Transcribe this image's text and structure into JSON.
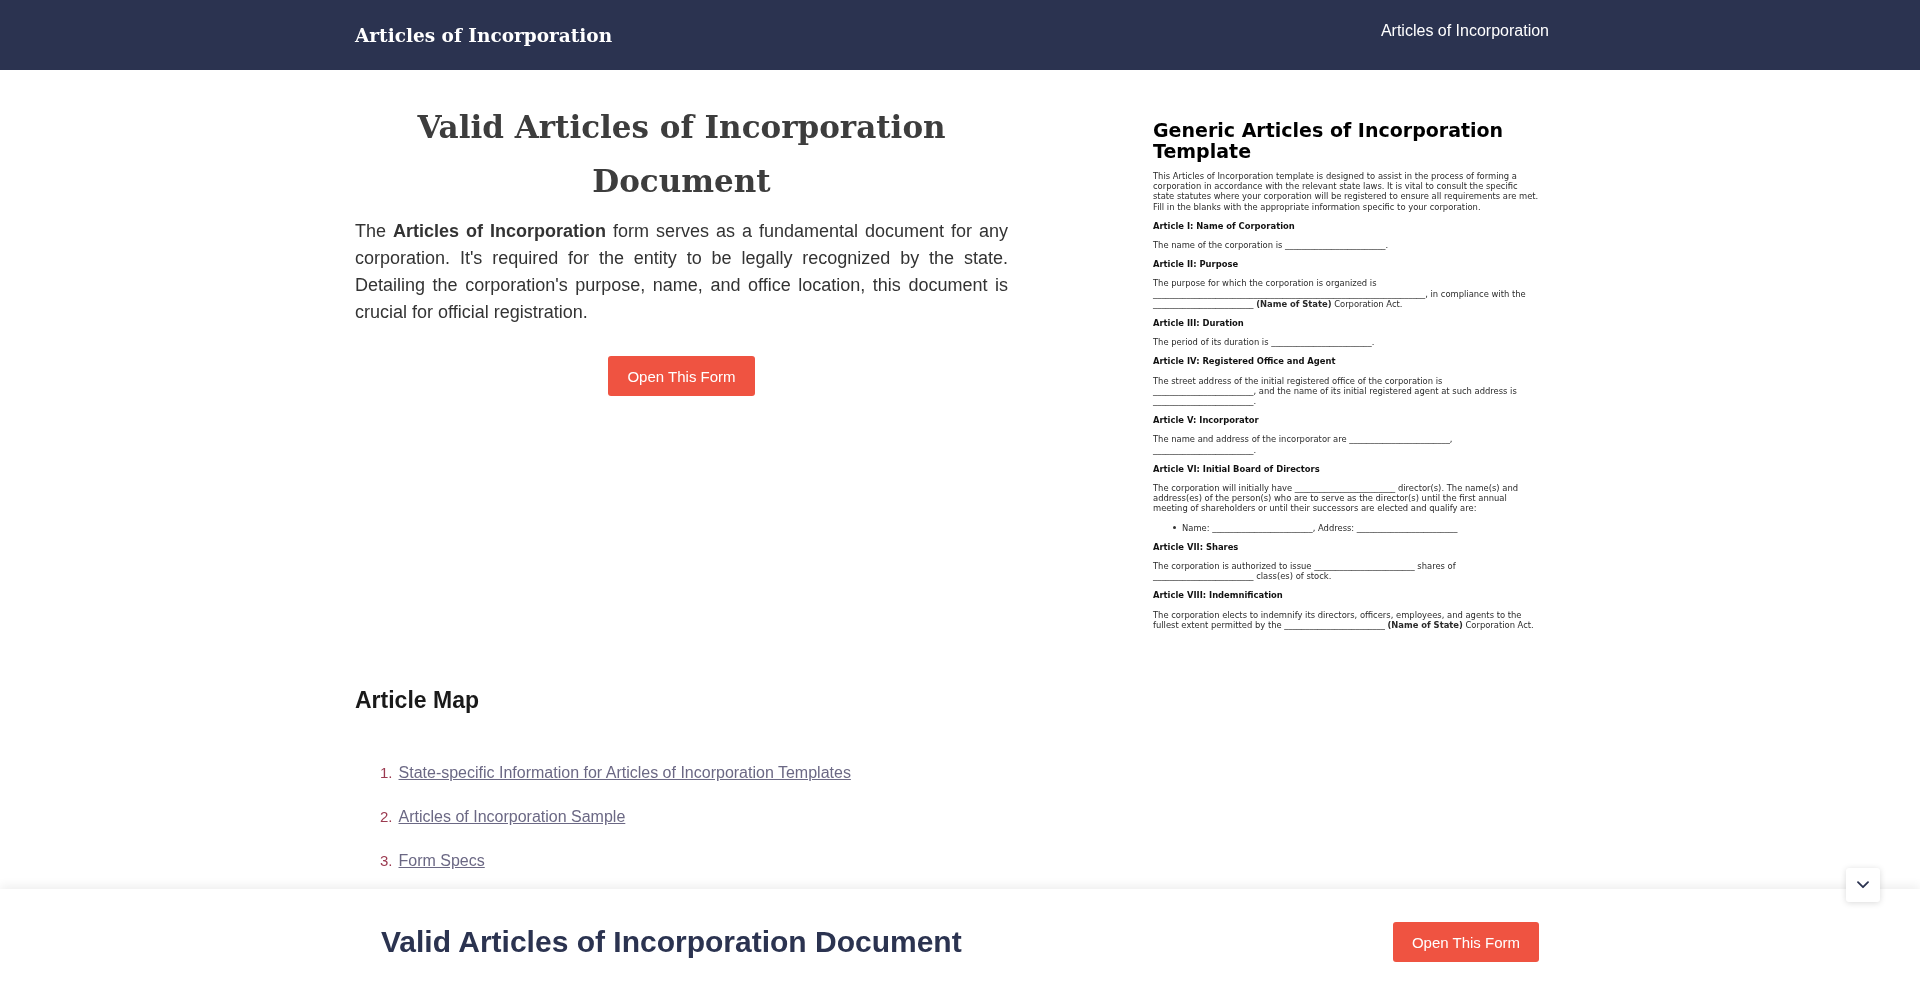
{
  "header": {
    "title": "Articles of Incorporation",
    "nav_link": "Articles of Incorporation"
  },
  "intro": {
    "heading": "Valid Articles of Incorporation Document",
    "paragraph": "The **Articles of Incorporation** form serves as a fundamental document for any corporation. It's required for the entity to be legally recognized by the state. Detailing the corporation's purpose, name, and office location, this document is crucial for official registration.",
    "button": "Open This Form"
  },
  "document_preview": {
    "title": "Generic Articles of Incorporation Template",
    "intro": "This Articles of Incorporation template is designed to assist in the process of forming a corporation in accordance with the relevant state laws. It is vital to consult the specific state statutes where your corporation will be registered to ensure all requirements are met. Fill in the blanks with the appropriate information specific to your corporation.",
    "sections": [
      {
        "heading": "Article I: Name of Corporation",
        "paragraphs": [
          "The name of the corporation is ________________________."
        ]
      },
      {
        "heading": "Article II: Purpose",
        "paragraphs": [
          "The purpose for which the corporation is organized is _________________________________________________________________, in compliance with the ________________________ **(Name of State)** Corporation Act."
        ]
      },
      {
        "heading": "Article III: Duration",
        "paragraphs": [
          "The period of its duration is ________________________."
        ]
      },
      {
        "heading": "Article IV: Registered Office and Agent",
        "paragraphs": [
          "The street address of the initial registered office of the corporation is ________________________, and the name of its initial registered agent at such address is ________________________."
        ]
      },
      {
        "heading": "Article V: Incorporator",
        "paragraphs": [
          "The name and address of the incorporator are ________________________, ________________________."
        ]
      },
      {
        "heading": "Article VI: Initial Board of Directors",
        "paragraphs": [
          "The corporation will initially have ________________________ director(s). The name(s) and address(es) of the person(s) who are to serve as the director(s) until the first annual meeting of shareholders or until their successors are elected and qualify are:"
        ],
        "bullets": [
          "Name: ________________________, Address: ________________________"
        ]
      },
      {
        "heading": "Article VII: Shares",
        "paragraphs": [
          "The corporation is authorized to issue ________________________ shares of ________________________ class(es) of stock."
        ]
      },
      {
        "heading": "Article VIII: Indemnification",
        "paragraphs": [
          "The corporation elects to indemnify its directors, officers, employees, and agents to the fullest extent permitted by the ________________________ **(Name of State)** Corporation Act."
        ]
      }
    ]
  },
  "article_map": {
    "heading": "Article Map",
    "items": [
      {
        "number": "1.",
        "label": "State-specific Information for Articles of Incorporation Templates"
      },
      {
        "number": "2.",
        "label": "Articles of Incorporation Sample"
      },
      {
        "number": "3.",
        "label": "Form Specs"
      }
    ]
  },
  "sticky_bar": {
    "title": "Valid Articles of Incorporation Document",
    "button": "Open This Form"
  }
}
